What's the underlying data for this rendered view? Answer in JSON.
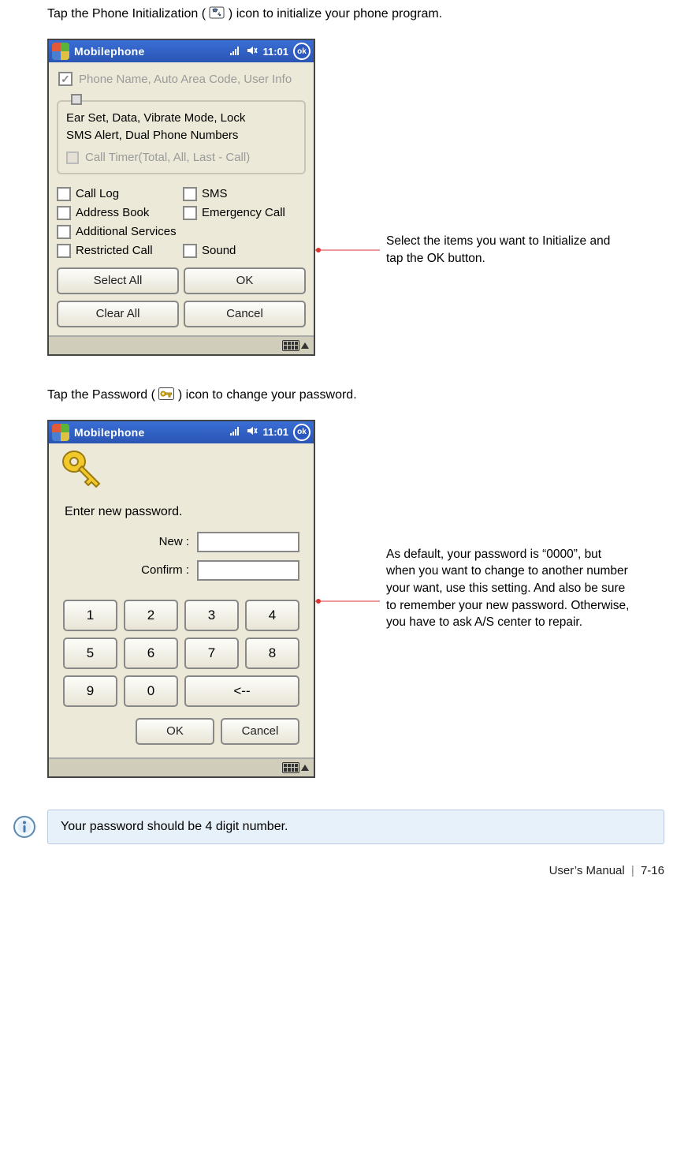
{
  "intro1_pre": "Tap the Phone Initialization (",
  "intro1_post": ") icon to initialize your phone program.",
  "intro2_pre": "Tap the Password (",
  "intro2_post": ") icon to change your password.",
  "titlebar": {
    "app": "Mobilephone",
    "time": "11:01",
    "ok": "ok"
  },
  "screen1": {
    "top_disabled": "Phone Name, Auto Area Code, User Info",
    "fieldset_line1": "Ear Set, Data, Vibrate Mode,  Lock",
    "fieldset_line2": "SMS Alert, Dual Phone Numbers",
    "fieldset_disabled": "Call Timer(Total, All, Last - Call)",
    "checks": {
      "call_log": "Call Log",
      "sms": "SMS",
      "address_book": "Address Book",
      "emergency_call": "Emergency Call",
      "additional_services": "Additional Services",
      "restricted_call": "Restricted Call",
      "sound": "Sound"
    },
    "buttons": {
      "select_all": "Select All",
      "ok": "OK",
      "clear_all": "Clear All",
      "cancel": "Cancel"
    }
  },
  "callout1": "Select the items you want to Initialize and tap the OK button.",
  "screen2": {
    "enter_title": "Enter new password.",
    "new_label": "New :",
    "confirm_label": "Confirm :",
    "keys": {
      "k1": "1",
      "k2": "2",
      "k3": "3",
      "k4": "4",
      "k5": "5",
      "k6": "6",
      "k7": "7",
      "k8": "8",
      "k9": "9",
      "k0": "0",
      "back": "<--"
    },
    "ok": "OK",
    "cancel": "Cancel"
  },
  "callout2": "As default, your password is “0000”, but when you want to change to another number your want, use this setting. And also be sure to remember your new password. Otherwise, you have to ask A/S center to repair.",
  "note": "Your password should be 4 digit number.",
  "footer": {
    "manual": "User’s Manual",
    "sep": "|",
    "page": "7-16"
  }
}
